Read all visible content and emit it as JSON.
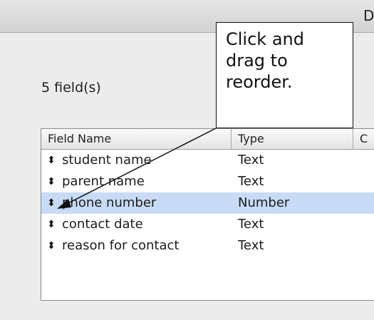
{
  "window": {
    "title_fragment": "D"
  },
  "summary": {
    "field_count": "5 field(s)"
  },
  "table": {
    "columns": [
      "Field Name",
      "Type",
      "C"
    ],
    "rows": [
      {
        "name": "student name",
        "type": "Text",
        "selected": false
      },
      {
        "name": "parent name",
        "type": "Text",
        "selected": false
      },
      {
        "name": "phone number",
        "type": "Number",
        "selected": true
      },
      {
        "name": "contact date",
        "type": "Text",
        "selected": false
      },
      {
        "name": "reason for contact",
        "type": "Text",
        "selected": false
      }
    ]
  },
  "annotation": {
    "lines": [
      "Click and",
      "drag to",
      "reorder."
    ]
  },
  "icons": {
    "row_handle": "reorder-handle-icon",
    "arrow": "callout-arrow-icon"
  },
  "colors": {
    "selected_row": "#c8dbf6",
    "window_bg": "#ececec"
  }
}
